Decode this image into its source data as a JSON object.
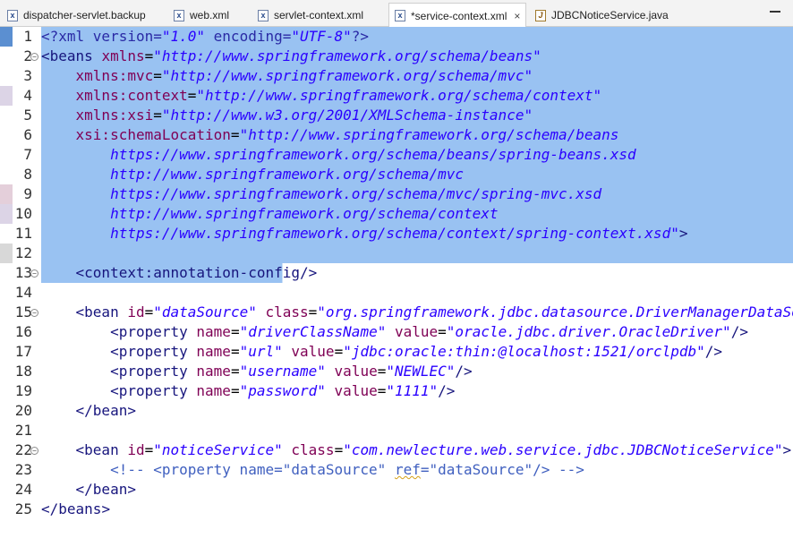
{
  "tabs": [
    {
      "label": "dispatcher-servlet.backup",
      "icon": "xml-file-icon",
      "active": false
    },
    {
      "label": "web.xml",
      "icon": "xml-file-icon",
      "active": false
    },
    {
      "label": "servlet-context.xml",
      "icon": "xml-file-icon",
      "active": false
    },
    {
      "label": "*service-context.xml",
      "icon": "xml-file-icon",
      "active": true,
      "close": "×"
    },
    {
      "label": "JDBCNoticeService.java",
      "icon": "java-file-icon",
      "active": false
    }
  ],
  "colors": {
    "selection": "#99c2f2",
    "tag": "#17157d",
    "attribute": "#7f0055",
    "string": "#2a00ff",
    "comment": "#3f5fbf"
  },
  "editor": {
    "selected_lines": "1-13",
    "lines": [
      {
        "n": "1",
        "text": "<?xml version=\"1.0\" encoding=\"UTF-8\"?>"
      },
      {
        "n": "2",
        "text": "<beans xmlns=\"http://www.springframework.org/schema/beans\""
      },
      {
        "n": "3",
        "text": "    xmlns:mvc=\"http://www.springframework.org/schema/mvc\""
      },
      {
        "n": "4",
        "text": "    xmlns:context=\"http://www.springframework.org/schema/context\""
      },
      {
        "n": "5",
        "text": "    xmlns:xsi=\"http://www.w3.org/2001/XMLSchema-instance\""
      },
      {
        "n": "6",
        "text": "    xsi:schemaLocation=\"http://www.springframework.org/schema/beans"
      },
      {
        "n": "7",
        "text": "        https://www.springframework.org/schema/beans/spring-beans.xsd"
      },
      {
        "n": "8",
        "text": "        http://www.springframework.org/schema/mvc"
      },
      {
        "n": "9",
        "text": "        https://www.springframework.org/schema/mvc/spring-mvc.xsd"
      },
      {
        "n": "10",
        "text": "        http://www.springframework.org/schema/context"
      },
      {
        "n": "11",
        "text": "        https://www.springframework.org/schema/context/spring-context.xsd\">"
      },
      {
        "n": "12",
        "text": ""
      },
      {
        "n": "13",
        "text": "    <context:annotation-config/>"
      },
      {
        "n": "14",
        "text": ""
      },
      {
        "n": "15",
        "text": "    <bean id=\"dataSource\" class=\"org.springframework.jdbc.datasource.DriverManagerDataSource\">"
      },
      {
        "n": "16",
        "text": "        <property name=\"driverClassName\" value=\"oracle.jdbc.driver.OracleDriver\"/>"
      },
      {
        "n": "17",
        "text": "        <property name=\"url\" value=\"jdbc:oracle:thin:@localhost:1521/orclpdb\"/>"
      },
      {
        "n": "18",
        "text": "        <property name=\"username\" value=\"NEWLEC\"/>"
      },
      {
        "n": "19",
        "text": "        <property name=\"password\" value=\"1111\"/>"
      },
      {
        "n": "20",
        "text": "    </bean>"
      },
      {
        "n": "21",
        "text": ""
      },
      {
        "n": "22",
        "text": "    <bean id=\"noticeService\" class=\"com.newlecture.web.service.jdbc.JDBCNoticeService\">"
      },
      {
        "n": "23",
        "text": "        <!-- <property name=\"dataSource\" ref=\"dataSource\"/> -->"
      },
      {
        "n": "24",
        "text": "    </bean>"
      },
      {
        "n": "25",
        "text": "</beans>"
      }
    ]
  }
}
